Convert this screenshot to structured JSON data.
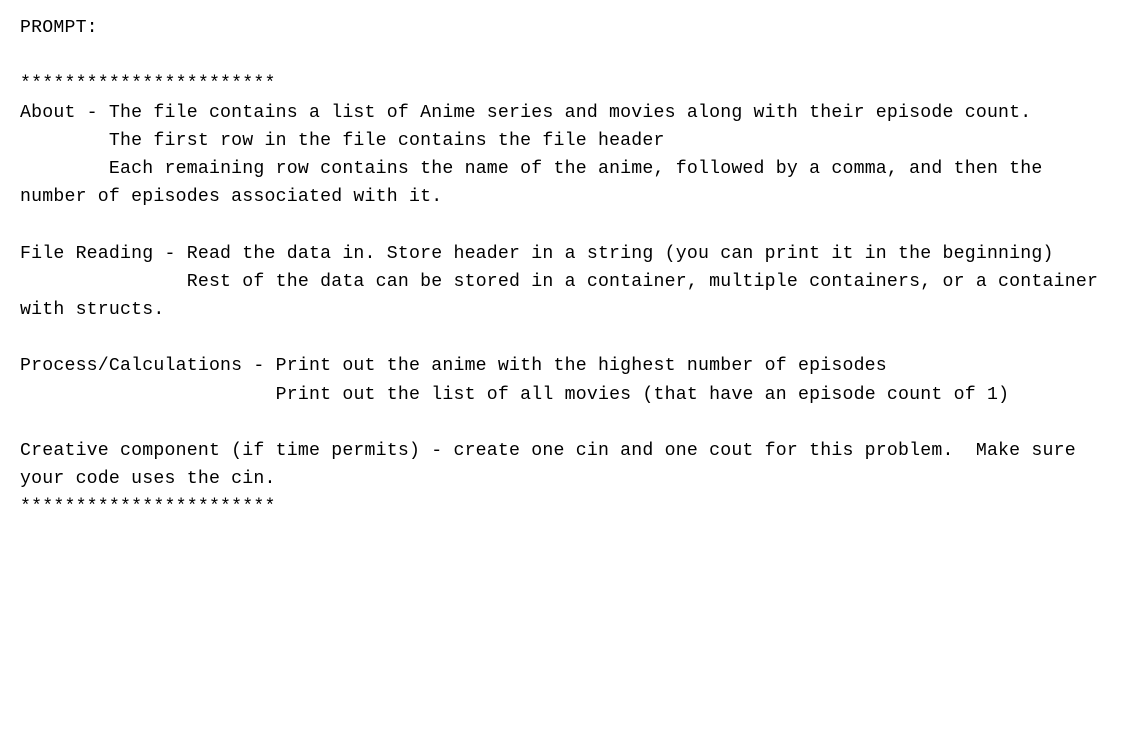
{
  "doc": {
    "prompt_label": "PROMPT:",
    "divider_top": "***********************",
    "about_line1": "About - The file contains a list of Anime series and movies along with their episode count.",
    "about_line2": "        The first row in the file contains the file header",
    "about_line3": "        Each remaining row contains the name of the anime, followed by a comma, and then the number of episodes associated with it.",
    "file_line1": "File Reading - Read the data in. Store header in a string (you can print it in the beginning)",
    "file_line2": "               Rest of the data can be stored in a container, multiple containers, or a container with structs.",
    "process_line1": "Process/Calculations - Print out the anime with the highest number of episodes",
    "process_line2": "                       Print out the list of all movies (that have an episode count of 1)",
    "creative_line": "Creative component (if time permits) - create one cin and one cout for this problem.  Make sure your code uses the cin.",
    "divider_bottom": "***********************"
  }
}
